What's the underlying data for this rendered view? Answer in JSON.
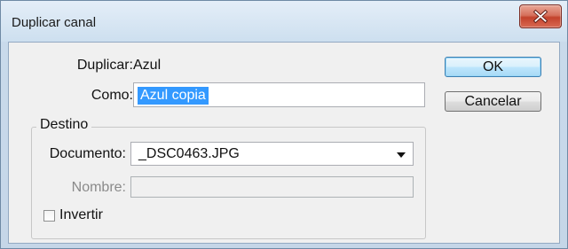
{
  "window": {
    "title": "Duplicar canal"
  },
  "duplicate": {
    "label": "Duplicar:",
    "value": "Azul"
  },
  "as": {
    "label": "Como:",
    "value": "Azul copia"
  },
  "destination": {
    "legend": "Destino",
    "document_label": "Documento:",
    "document_value": "_DSC0463.JPG",
    "name_label": "Nombre:",
    "name_value": "",
    "invert_label": "Invertir",
    "invert_checked": false
  },
  "buttons": {
    "ok": "OK",
    "cancel": "Cancelar"
  },
  "colors": {
    "selection": "#3399ff",
    "disabled_text": "#8a8a8a"
  }
}
